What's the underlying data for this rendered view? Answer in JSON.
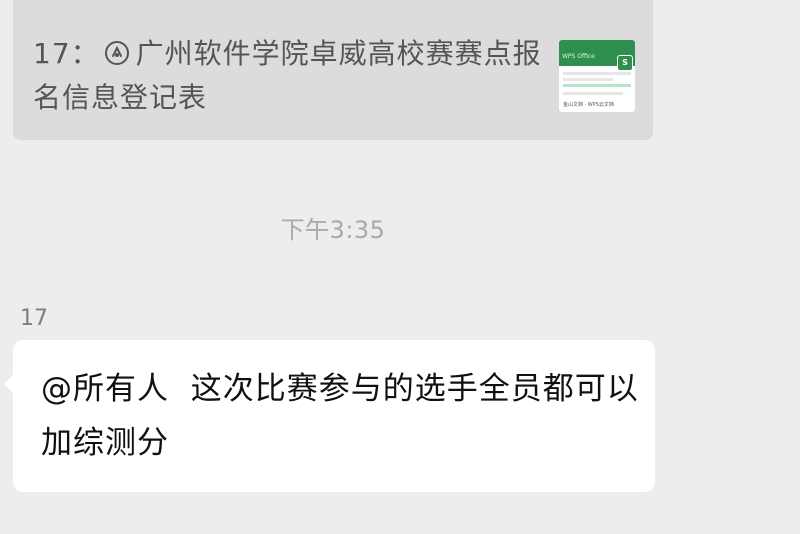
{
  "quoted_message": {
    "prefix": "17：",
    "text": "广州软件学院卓威高校赛赛点报名信息登记表",
    "link_icon": "mini-program-link-icon",
    "thumbnail": {
      "app_name": "WPS Office",
      "badge": "S",
      "footer": "金山文档 · WPS云文档"
    }
  },
  "timestamp": "下午3:35",
  "message": {
    "sender": "17",
    "text": "@所有人  这次比赛参与的选手全员都可以加综测分"
  },
  "colors": {
    "background": "#ededed",
    "quote_card": "#dcdcdc",
    "bubble": "#ffffff",
    "wps_green": "#2f8f4f"
  }
}
